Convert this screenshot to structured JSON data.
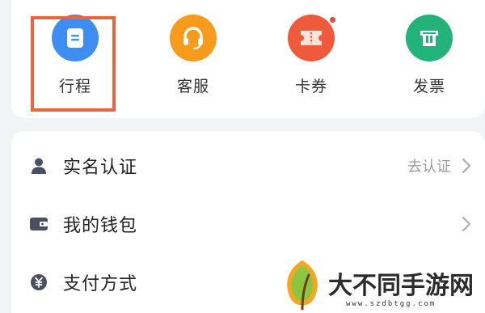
{
  "quick_actions": [
    {
      "label": "行程",
      "icon": "itinerary-icon",
      "color": "#3d8ef0",
      "highlighted": true
    },
    {
      "label": "客服",
      "icon": "headset-icon",
      "color": "#f79b1c"
    },
    {
      "label": "卡券",
      "icon": "coupon-icon",
      "color": "#ef5a3c",
      "badge": true
    },
    {
      "label": "发票",
      "icon": "invoice-icon",
      "color": "#22b27a"
    }
  ],
  "menu": [
    {
      "label": "实名认证",
      "icon": "person-icon",
      "hint": "去认证"
    },
    {
      "label": "我的钱包",
      "icon": "wallet-icon",
      "hint": ""
    },
    {
      "label": "支付方式",
      "icon": "yuan-icon",
      "hint": ""
    }
  ],
  "watermark": {
    "text": "大不同手游网",
    "url": "www.szdbtgg.com"
  },
  "colors": {
    "highlight_border": "#e8663d",
    "badge_red": "#e8453c",
    "icon_gray": "#4a5060"
  }
}
